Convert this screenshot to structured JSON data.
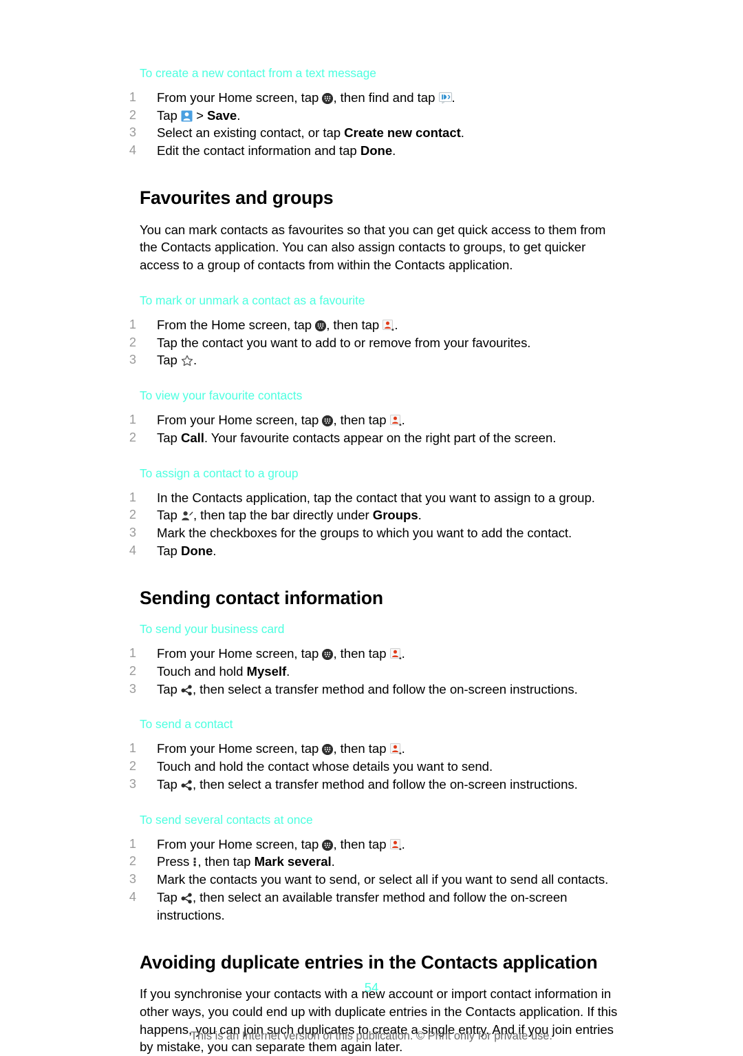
{
  "document": {
    "page_number": "54",
    "footer_note": "This is an Internet version of this publication. © Print only for private use.",
    "heading_color": "#4dffe0",
    "body_color": "#000000",
    "number_color": "#9a9a9a",
    "footer_color": "#6b6b6b"
  },
  "sections": {
    "create_contact_from_sms": {
      "subtitle": "To create a new contact from a text message",
      "steps": [
        {
          "parts": [
            {
              "type": "text",
              "value": "From your Home screen, tap "
            },
            {
              "type": "icon",
              "icon": "app-drawer-icon"
            },
            {
              "type": "text",
              "value": ", then find and tap "
            },
            {
              "type": "icon",
              "icon": "messaging-icon"
            },
            {
              "type": "text",
              "value": "."
            }
          ]
        },
        {
          "parts": [
            {
              "type": "text",
              "value": "Tap "
            },
            {
              "type": "icon",
              "icon": "save-contact-icon"
            },
            {
              "type": "text",
              "value": " > "
            },
            {
              "type": "bold",
              "value": "Save"
            },
            {
              "type": "text",
              "value": "."
            }
          ]
        },
        {
          "parts": [
            {
              "type": "text",
              "value": "Select an existing contact, or tap "
            },
            {
              "type": "bold",
              "value": "Create new contact"
            },
            {
              "type": "text",
              "value": "."
            }
          ]
        },
        {
          "parts": [
            {
              "type": "text",
              "value": "Edit the contact information and tap "
            },
            {
              "type": "bold",
              "value": "Done"
            },
            {
              "type": "text",
              "value": "."
            }
          ]
        }
      ]
    },
    "favourites_and_groups": {
      "title": "Favourites and groups",
      "intro": "You can mark contacts as favourites so that you can get quick access to them from the Contacts application. You can also assign contacts to groups, to get quicker access to a group of contacts from within the Contacts application.",
      "mark_favourite": {
        "subtitle": "To mark or unmark a contact as a favourite",
        "steps": [
          {
            "parts": [
              {
                "type": "text",
                "value": "From the Home screen, tap "
              },
              {
                "type": "icon",
                "icon": "app-drawer-icon"
              },
              {
                "type": "text",
                "value": ", then tap "
              },
              {
                "type": "icon",
                "icon": "contacts-icon"
              },
              {
                "type": "text",
                "value": "."
              }
            ]
          },
          {
            "parts": [
              {
                "type": "text",
                "value": "Tap the contact you want to add to or remove from your favourites."
              }
            ]
          },
          {
            "parts": [
              {
                "type": "text",
                "value": "Tap "
              },
              {
                "type": "icon",
                "icon": "star-icon"
              },
              {
                "type": "text",
                "value": "."
              }
            ]
          }
        ]
      },
      "view_favourites": {
        "subtitle": "To view your favourite contacts",
        "steps": [
          {
            "parts": [
              {
                "type": "text",
                "value": "From your Home screen, tap "
              },
              {
                "type": "icon",
                "icon": "app-drawer-icon"
              },
              {
                "type": "text",
                "value": ", then tap "
              },
              {
                "type": "icon",
                "icon": "contacts-icon"
              },
              {
                "type": "text",
                "value": "."
              }
            ]
          },
          {
            "parts": [
              {
                "type": "text",
                "value": "Tap "
              },
              {
                "type": "bold",
                "value": "Call"
              },
              {
                "type": "text",
                "value": ". Your favourite contacts appear on the right part of the screen."
              }
            ]
          }
        ]
      },
      "assign_group": {
        "subtitle": "To assign a contact to a group",
        "steps": [
          {
            "parts": [
              {
                "type": "text",
                "value": "In the Contacts application, tap the contact that you want to assign to a group."
              }
            ]
          },
          {
            "parts": [
              {
                "type": "text",
                "value": "Tap "
              },
              {
                "type": "icon",
                "icon": "edit-contact-icon"
              },
              {
                "type": "text",
                "value": ", then tap the bar directly under "
              },
              {
                "type": "bold",
                "value": "Groups"
              },
              {
                "type": "text",
                "value": "."
              }
            ]
          },
          {
            "parts": [
              {
                "type": "text",
                "value": "Mark the checkboxes for the groups to which you want to add the contact."
              }
            ]
          },
          {
            "parts": [
              {
                "type": "text",
                "value": "Tap "
              },
              {
                "type": "bold",
                "value": "Done"
              },
              {
                "type": "text",
                "value": "."
              }
            ]
          }
        ]
      }
    },
    "sending_contact_information": {
      "title": "Sending contact information",
      "send_business_card": {
        "subtitle": "To send your business card",
        "steps": [
          {
            "parts": [
              {
                "type": "text",
                "value": "From your Home screen, tap "
              },
              {
                "type": "icon",
                "icon": "app-drawer-icon"
              },
              {
                "type": "text",
                "value": ", then tap "
              },
              {
                "type": "icon",
                "icon": "contacts-icon"
              },
              {
                "type": "text",
                "value": "."
              }
            ]
          },
          {
            "parts": [
              {
                "type": "text",
                "value": "Touch and hold "
              },
              {
                "type": "bold",
                "value": "Myself"
              },
              {
                "type": "text",
                "value": "."
              }
            ]
          },
          {
            "parts": [
              {
                "type": "text",
                "value": "Tap "
              },
              {
                "type": "icon",
                "icon": "share-icon"
              },
              {
                "type": "text",
                "value": ", then select a transfer method and follow the on-screen instructions."
              }
            ]
          }
        ]
      },
      "send_a_contact": {
        "subtitle": "To send a contact",
        "steps": [
          {
            "parts": [
              {
                "type": "text",
                "value": "From your Home screen, tap "
              },
              {
                "type": "icon",
                "icon": "app-drawer-icon"
              },
              {
                "type": "text",
                "value": ", then tap "
              },
              {
                "type": "icon",
                "icon": "contacts-icon"
              },
              {
                "type": "text",
                "value": "."
              }
            ]
          },
          {
            "parts": [
              {
                "type": "text",
                "value": "Touch and hold the contact whose details you want to send."
              }
            ]
          },
          {
            "parts": [
              {
                "type": "text",
                "value": "Tap "
              },
              {
                "type": "icon",
                "icon": "share-icon"
              },
              {
                "type": "text",
                "value": ", then select a transfer method and follow the on-screen instructions."
              }
            ]
          }
        ]
      },
      "send_several_contacts": {
        "subtitle": "To send several contacts at once",
        "steps": [
          {
            "parts": [
              {
                "type": "text",
                "value": "From your Home screen, tap "
              },
              {
                "type": "icon",
                "icon": "app-drawer-icon"
              },
              {
                "type": "text",
                "value": ", then tap "
              },
              {
                "type": "icon",
                "icon": "contacts-icon"
              },
              {
                "type": "text",
                "value": "."
              }
            ]
          },
          {
            "parts": [
              {
                "type": "text",
                "value": "Press "
              },
              {
                "type": "icon",
                "icon": "overflow-menu-icon"
              },
              {
                "type": "text",
                "value": ", then tap "
              },
              {
                "type": "bold",
                "value": "Mark several"
              },
              {
                "type": "text",
                "value": "."
              }
            ]
          },
          {
            "parts": [
              {
                "type": "text",
                "value": "Mark the contacts you want to send, or select all if you want to send all contacts."
              }
            ]
          },
          {
            "parts": [
              {
                "type": "text",
                "value": "Tap "
              },
              {
                "type": "icon",
                "icon": "share-icon"
              },
              {
                "type": "text",
                "value": ", then select an available transfer method and follow the on-screen instructions."
              }
            ]
          }
        ]
      }
    },
    "avoiding_duplicates": {
      "title": "Avoiding duplicate entries in the Contacts application",
      "intro": "If you synchronise your contacts with a new account or import contact information in other ways, you could end up with duplicate entries in the Contacts application. If this happens, you can join such duplicates to create a single entry. And if you join entries by mistake, you can separate them again later."
    }
  }
}
